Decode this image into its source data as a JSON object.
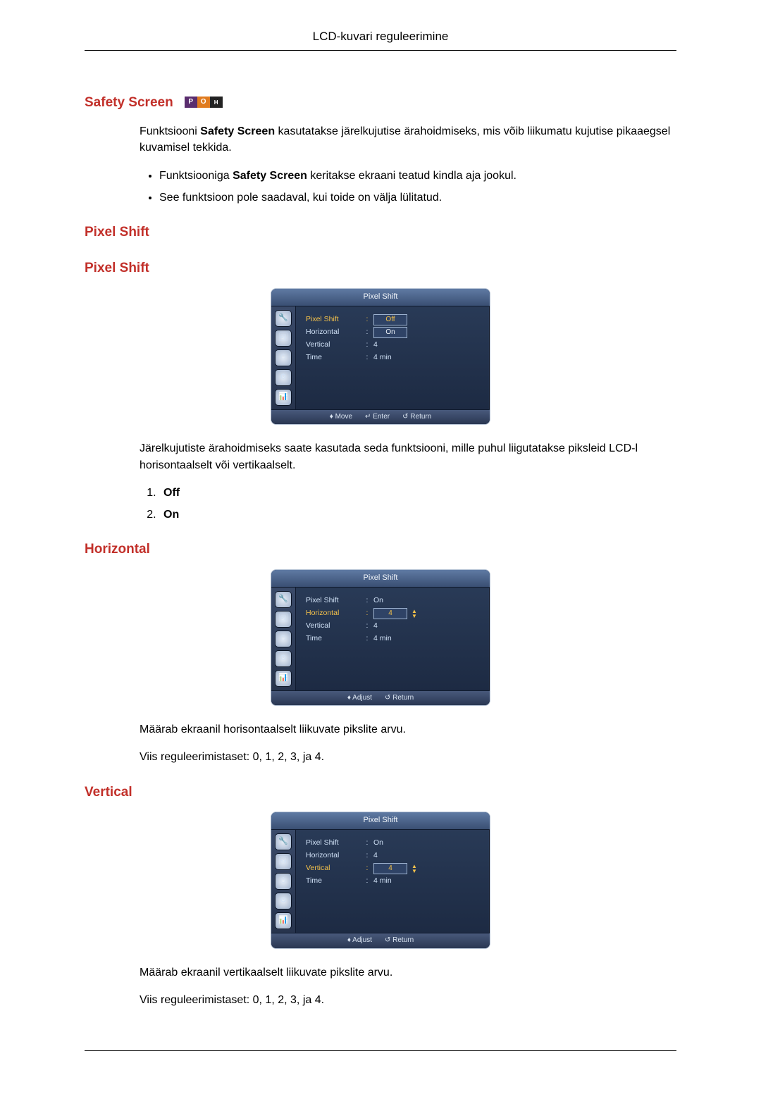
{
  "doc": {
    "header": "LCD-kuvari reguleerimine"
  },
  "sections": {
    "safetyScreen": {
      "title": "Safety Screen",
      "intro_pre": "Funktsiooni ",
      "intro_bold": "Safety Screen",
      "intro_post": " kasutatakse järelkujutise ärahoidmiseks, mis võib liikumatu kujutise pikaaegsel kuvamisel tekkida.",
      "bullets": [
        {
          "pre": "Funktsiooniga ",
          "bold": "Safety Screen",
          "post": " keritakse ekraani teatud kindla aja jookul."
        },
        {
          "pre": "",
          "bold": "",
          "post": "See funktsioon pole saadaval, kui toide on välja lülitatud."
        }
      ]
    },
    "pixelShiftHeader": {
      "title": "Pixel Shift"
    },
    "pixelShift": {
      "title": "Pixel Shift",
      "desc": "Järelkujutiste ärahoidmiseks saate kasutada seda funktsiooni, mille puhul liigutatakse piksleid LCD-l horisontaalselt või vertikaalselt.",
      "options": [
        "Off",
        "On"
      ]
    },
    "horizontal": {
      "title": "Horizontal",
      "desc1": "Määrab ekraanil horisontaalselt liikuvate pikslite arvu.",
      "desc2": "Viis reguleerimistaset: 0, 1, 2, 3, ja 4."
    },
    "vertical": {
      "title": "Vertical",
      "desc1": "Määrab ekraanil vertikaalselt liikuvate pikslite arvu.",
      "desc2": "Viis reguleerimistaset: 0, 1, 2, 3, ja 4."
    }
  },
  "osd": {
    "title": "Pixel Shift",
    "labels": {
      "pixelShift": "Pixel Shift",
      "horizontal": "Horizontal",
      "vertical": "Vertical",
      "time": "Time"
    },
    "footer": {
      "move": "Move",
      "enter": "Enter",
      "adjust": "Adjust",
      "return": "Return"
    },
    "screens": {
      "ps": {
        "active": "pixelShift",
        "pixelShiftChip": "Off",
        "pixelShiftChip2": "On",
        "horizontal": "",
        "vertical": "4",
        "time": "4 min",
        "showEnter": true
      },
      "hor": {
        "active": "horizontal",
        "pixelShift": "On",
        "horizontalChip": "4",
        "vertical": "4",
        "time": "4 min",
        "showEnter": false
      },
      "ver": {
        "active": "vertical",
        "pixelShift": "On",
        "horizontal": "4",
        "verticalChip": "4",
        "time": "4 min",
        "showEnter": false
      }
    }
  }
}
